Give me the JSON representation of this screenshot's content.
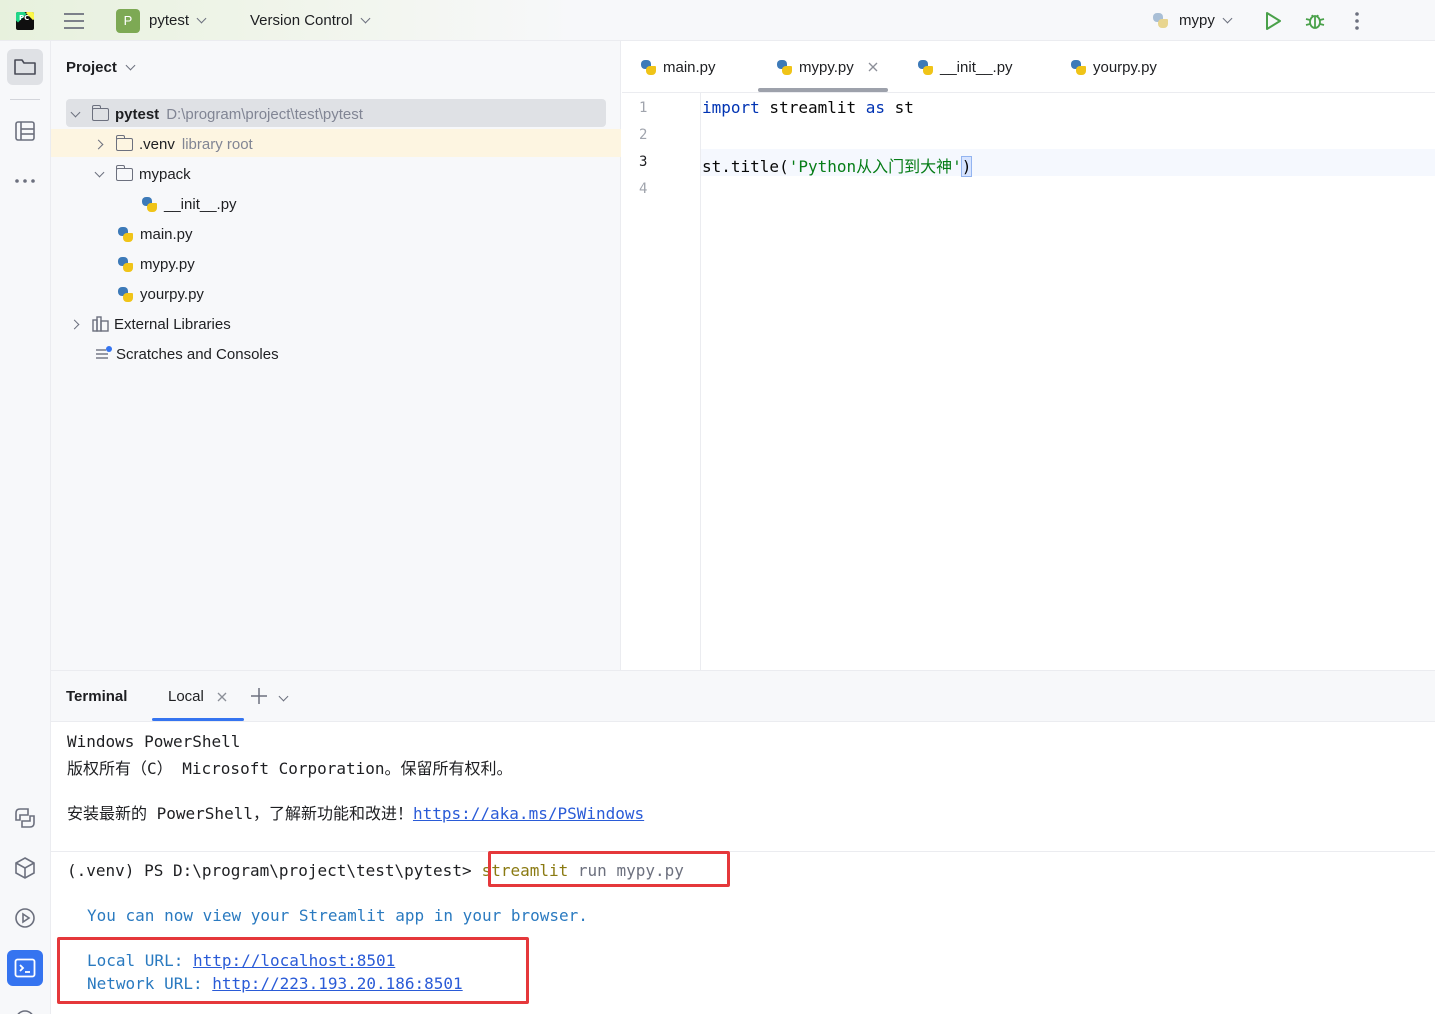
{
  "titlebar": {
    "project_badge": "P",
    "project_name": "pytest",
    "vcs": "Version Control",
    "run_config": "mypy"
  },
  "project_panel": {
    "title": "Project",
    "tree": [
      {
        "label": "pytest",
        "sub": "D:\\program\\project\\test\\pytest"
      },
      {
        "label": ".venv",
        "sub": "library root"
      },
      {
        "label": "mypack"
      },
      {
        "label": "__init__.py"
      },
      {
        "label": "main.py"
      },
      {
        "label": "mypy.py"
      },
      {
        "label": "yourpy.py"
      },
      {
        "label": "External Libraries"
      },
      {
        "label": "Scratches and Consoles"
      }
    ]
  },
  "editor": {
    "tabs": [
      "main.py",
      "mypy.py",
      "__init__.py",
      "yourpy.py"
    ],
    "line_numbers": [
      "1",
      "2",
      "3",
      "4"
    ],
    "code": {
      "l1_kw1": "import",
      "l1_mid": " streamlit ",
      "l1_kw2": "as",
      "l1_end": " st",
      "l3_pre": "st.title(",
      "l3_str": "'Python从入门到大神'",
      "l3_end": ")"
    }
  },
  "terminal": {
    "title": "Terminal",
    "tab": "Local",
    "lines": {
      "ps1": "Windows PowerShell",
      "ps2": "版权所有（C） Microsoft Corporation。保留所有权利。",
      "ps3_text": "安装最新的 PowerShell，了解新功能和改进！",
      "ps3_link": "https://aka.ms/PSWindows",
      "prompt": "(.venv) PS D:\\program\\project\\test\\pytest>",
      "cmd_name": "streamlit",
      "cmd_args": " run mypy.py",
      "info": "You can now view your Streamlit app in your browser.",
      "local_label": "Local URL: ",
      "local_url": "http://localhost:8501",
      "network_label": "Network URL: ",
      "network_url": "http://223.193.20.186:8501"
    }
  },
  "colors": {
    "highlight_box": "#e5383b",
    "keyword": "#0033b3",
    "string": "#067d17",
    "link": "#2a5bd7"
  }
}
